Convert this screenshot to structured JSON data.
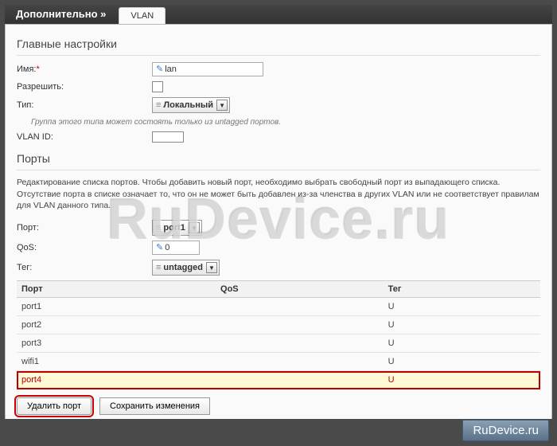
{
  "tabbar": {
    "back_label": "Дополнительно »",
    "tab_label": "VLAN"
  },
  "main_section": {
    "title": "Главные настройки",
    "name_label": "Имя:",
    "name_value": "lan",
    "allow_label": "Разрешить:",
    "type_label": "Тип:",
    "type_value": "Локальный",
    "type_hint": "Группа этого типа может состоять только из untagged портов.",
    "vlanid_label": "VLAN ID:"
  },
  "ports_section": {
    "title": "Порты",
    "desc": "Редактирование списка портов. Чтобы добавить новый порт, необходимо выбрать свободный порт из выпадающего списка. Отсутствие порта в списке означает то, что он не может быть добавлен из-за членства в других VLAN или не соответствует правилам для VLAN данного типа.",
    "port_label": "Порт:",
    "port_value": "port1",
    "qos_label": "QoS:",
    "qos_value": "0",
    "tag_label": "Тег:",
    "tag_value": "untagged",
    "headers": {
      "port": "Порт",
      "qos": "QoS",
      "tag": "Тег"
    },
    "rows": [
      {
        "port": "port1",
        "qos": "",
        "tag": "U"
      },
      {
        "port": "port2",
        "qos": "",
        "tag": "U"
      },
      {
        "port": "port3",
        "qos": "",
        "tag": "U"
      },
      {
        "port": "wifi1",
        "qos": "",
        "tag": "U"
      },
      {
        "port": "port4",
        "qos": "",
        "tag": "U"
      }
    ],
    "selected_index": 4
  },
  "buttons": {
    "delete_port": "Удалить порт",
    "save": "Сохранить изменения"
  },
  "watermark": "RuDevice.ru",
  "badge": "RuDevice.ru"
}
